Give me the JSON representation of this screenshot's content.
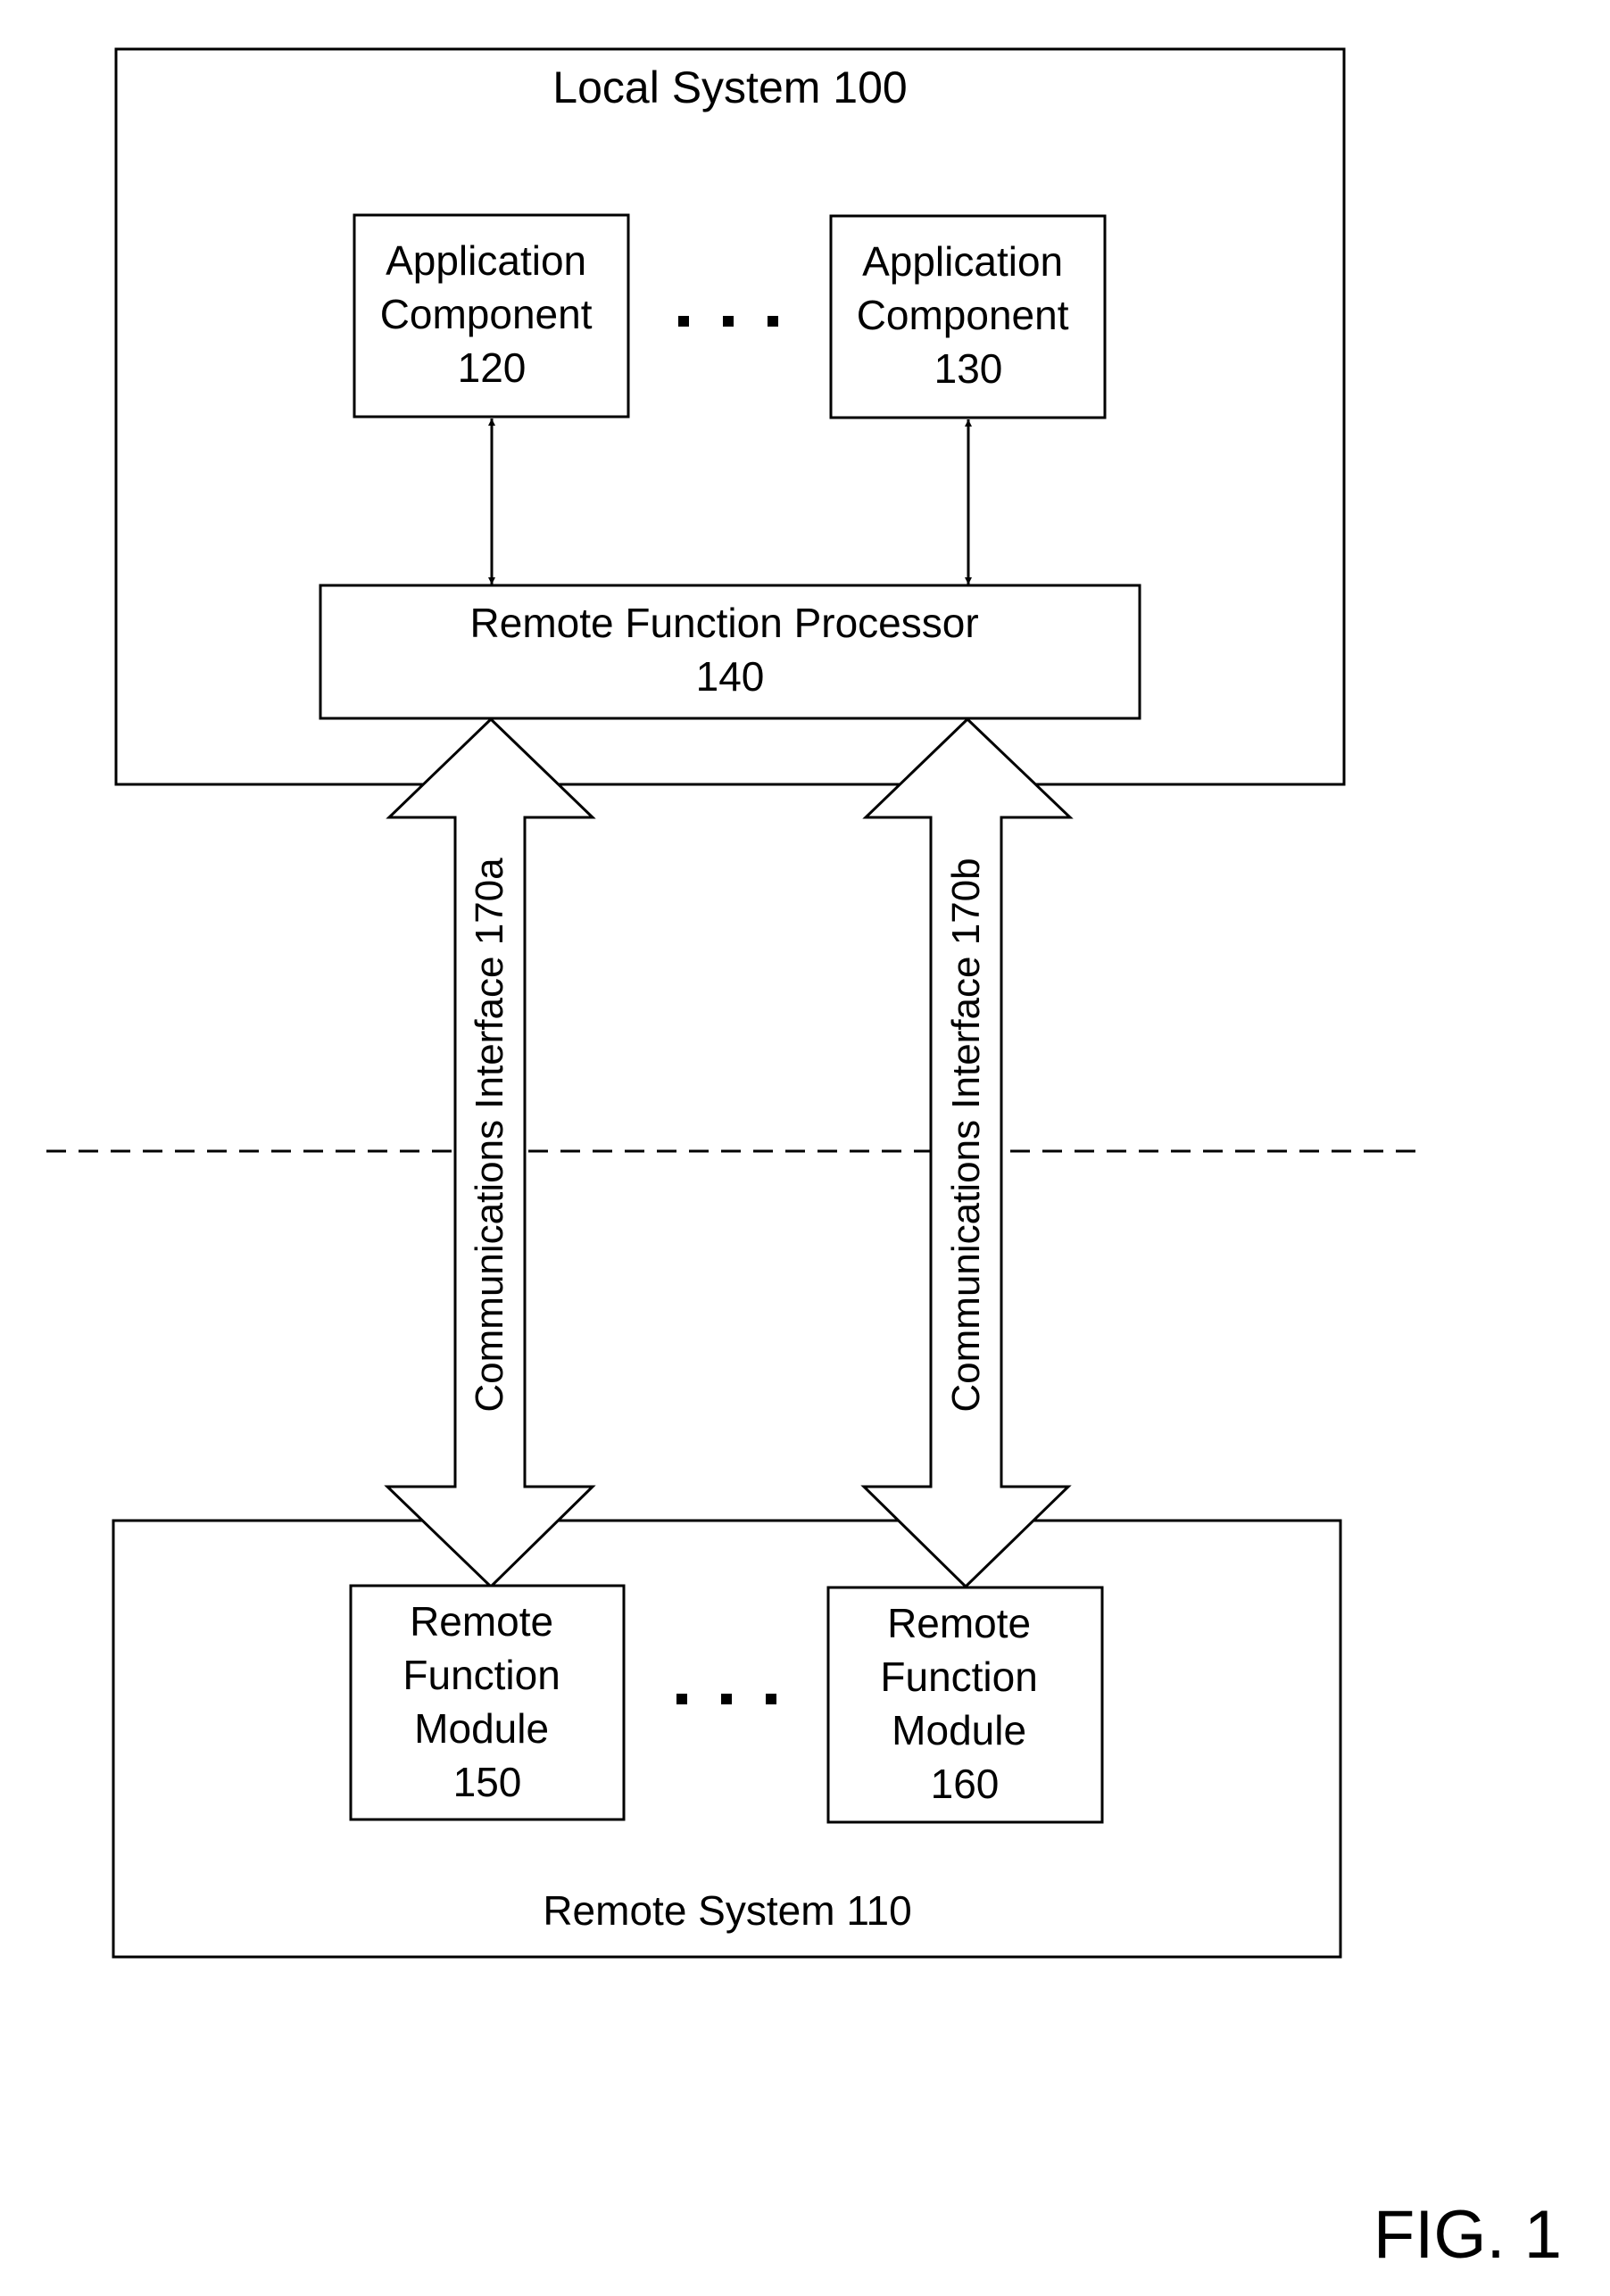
{
  "figure_label": "FIG. 1",
  "local_system": {
    "title": "Local System 100",
    "app_components": [
      {
        "lines": [
          "Application",
          "Component",
          "120"
        ]
      },
      {
        "lines": [
          "Application",
          "Component",
          "130"
        ]
      }
    ],
    "ellipsis": "• • •",
    "processor": {
      "lines": [
        "Remote Function Processor",
        "140"
      ]
    }
  },
  "interfaces": [
    {
      "label": "Communications Interface 170a"
    },
    {
      "label": "Communications Interface 170b"
    }
  ],
  "remote_system": {
    "title": "Remote System 110",
    "modules": [
      {
        "lines": [
          "Remote",
          "Function",
          "Module",
          "150"
        ]
      },
      {
        "lines": [
          "Remote",
          "Function",
          "Module",
          "160"
        ]
      }
    ],
    "ellipsis": "• • •"
  }
}
